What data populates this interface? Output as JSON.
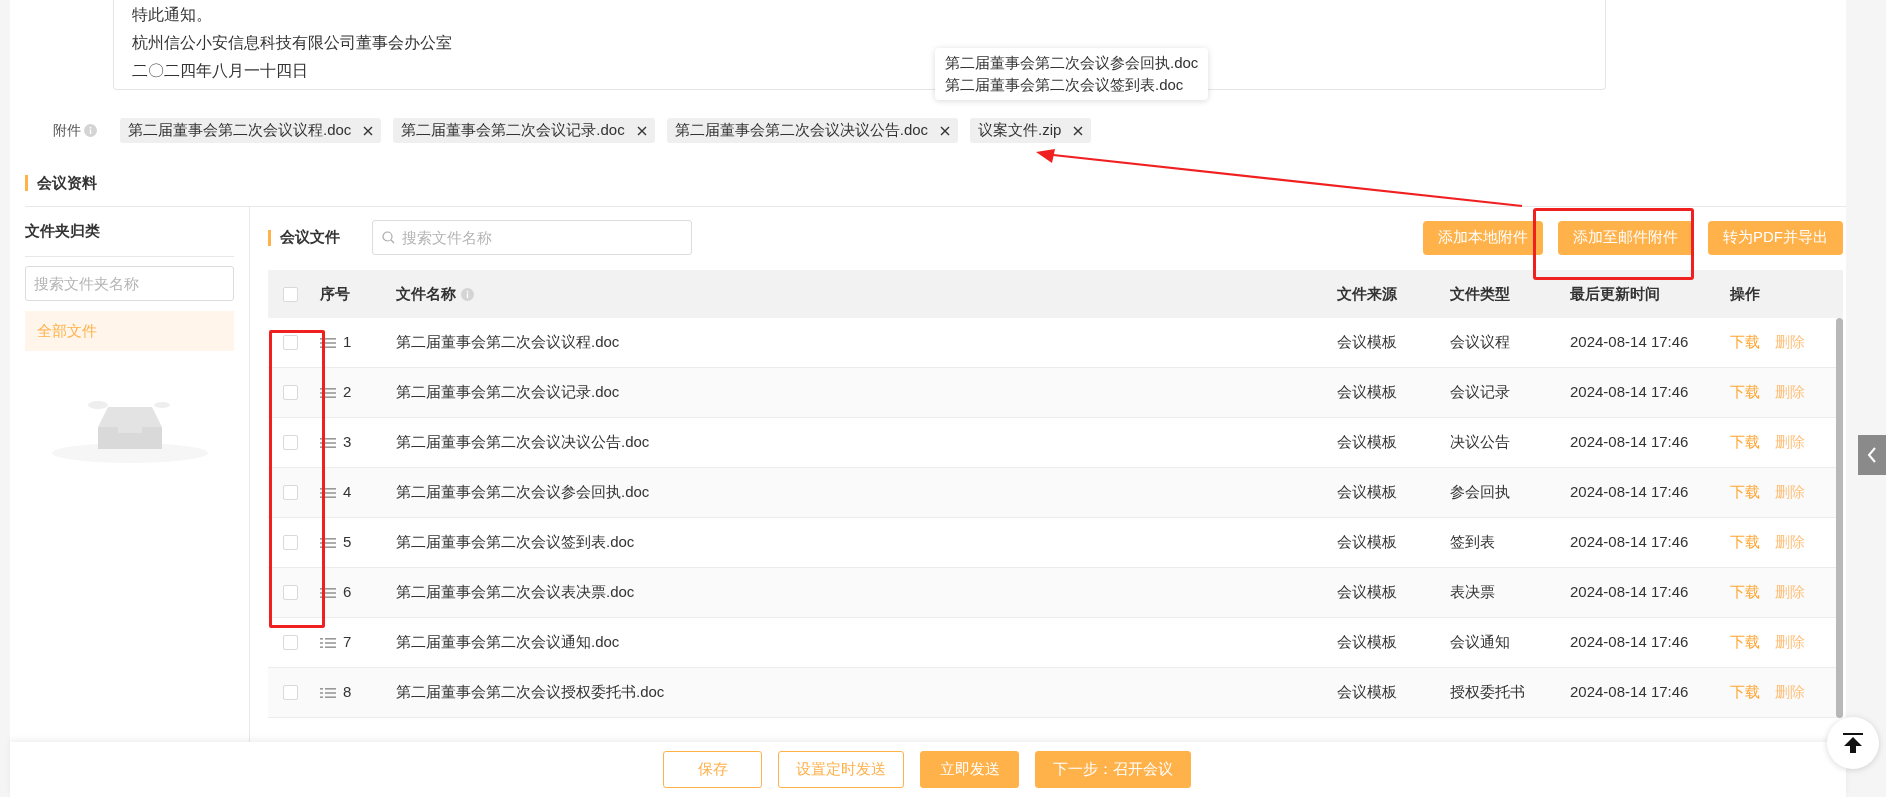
{
  "notice": {
    "lines": [
      "特此通知。",
      "杭州信公小安信息科技有限公司董事会办公室",
      "二〇二四年八月一十四日"
    ]
  },
  "attachments": {
    "label": "附件",
    "items": [
      {
        "name": "第二届董事会第二次会议议程.doc"
      },
      {
        "name": "第二届董事会第二次会议记录.doc"
      },
      {
        "name": "第二届董事会第二次会议决议公告.doc"
      },
      {
        "name": "议案文件.zip"
      }
    ]
  },
  "tooltip": {
    "lines": [
      "第二届董事会第二次会议参会回执.doc",
      "第二届董事会第二次会议签到表.doc"
    ]
  },
  "section_title": "会议资料",
  "folders": {
    "title": "文件夹归类",
    "search": {
      "placeholder": "搜索文件夹名称"
    },
    "items": [
      {
        "label": "全部文件",
        "selected": true
      }
    ]
  },
  "files": {
    "title": "会议文件",
    "search": {
      "placeholder": "搜索文件名称"
    },
    "buttons": [
      "添加本地附件",
      "添加至邮件附件",
      "转为PDF并导出"
    ],
    "select_all": {
      "checked": false
    },
    "columns": [
      {
        "label": "序号"
      },
      {
        "label": "文件名称"
      },
      {
        "label": "文件来源"
      },
      {
        "label": "文件类型"
      },
      {
        "label": "最后更新时间"
      },
      {
        "label": "操作"
      }
    ],
    "rows": [
      {
        "checked": false,
        "index": "1",
        "name": "第二届董事会第二次会议议程.doc",
        "source": "会议模板",
        "type": "会议议程",
        "updated": "2024-08-14 17:46",
        "actions": [
          "下载",
          "删除"
        ]
      },
      {
        "checked": false,
        "index": "2",
        "name": "第二届董事会第二次会议记录.doc",
        "source": "会议模板",
        "type": "会议记录",
        "updated": "2024-08-14 17:46",
        "actions": [
          "下载",
          "删除"
        ]
      },
      {
        "checked": false,
        "index": "3",
        "name": "第二届董事会第二次会议决议公告.doc",
        "source": "会议模板",
        "type": "决议公告",
        "updated": "2024-08-14 17:46",
        "actions": [
          "下载",
          "删除"
        ]
      },
      {
        "checked": false,
        "index": "4",
        "name": "第二届董事会第二次会议参会回执.doc",
        "source": "会议模板",
        "type": "参会回执",
        "updated": "2024-08-14 17:46",
        "actions": [
          "下载",
          "删除"
        ]
      },
      {
        "checked": false,
        "index": "5",
        "name": "第二届董事会第二次会议签到表.doc",
        "source": "会议模板",
        "type": "签到表",
        "updated": "2024-08-14 17:46",
        "actions": [
          "下载",
          "删除"
        ]
      },
      {
        "checked": false,
        "index": "6",
        "name": "第二届董事会第二次会议表决票.doc",
        "source": "会议模板",
        "type": "表决票",
        "updated": "2024-08-14 17:46",
        "actions": [
          "下载",
          "删除"
        ]
      },
      {
        "checked": false,
        "index": "7",
        "name": "第二届董事会第二次会议通知.doc",
        "source": "会议模板",
        "type": "会议通知",
        "updated": "2024-08-14 17:46",
        "actions": [
          "下载",
          "删除"
        ]
      },
      {
        "checked": false,
        "index": "8",
        "name": "第二届董事会第二次会议授权委托书.doc",
        "source": "会议模板",
        "type": "授权委托书",
        "updated": "2024-08-14 17:46",
        "actions": [
          "下载",
          "删除"
        ]
      }
    ]
  },
  "footer": {
    "buttons": [
      {
        "label": "保存",
        "kind": "outline"
      },
      {
        "label": "设置定时发送",
        "kind": "outline"
      },
      {
        "label": "立即发送",
        "kind": "filled"
      },
      {
        "label": "下一步：召开会议",
        "kind": "filled"
      }
    ]
  }
}
